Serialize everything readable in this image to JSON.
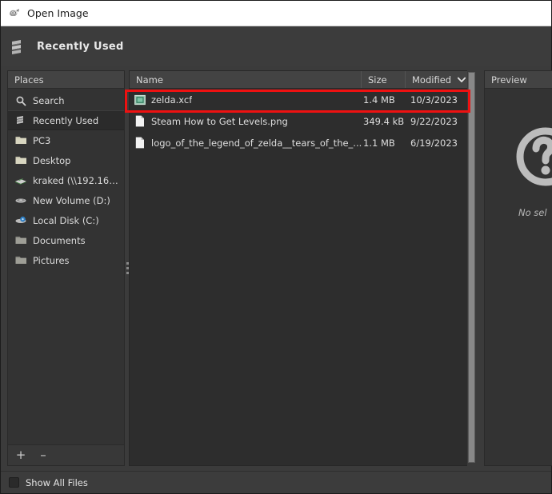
{
  "window": {
    "title": "Open Image",
    "title_icon": "gimp-wilber-icon"
  },
  "location_header": {
    "label": "Recently Used",
    "icon": "recently-used-stack-icon"
  },
  "sidebar": {
    "header": "Places",
    "items": [
      {
        "label": "Search",
        "icon": "search-icon",
        "selected": false
      },
      {
        "label": "Recently Used",
        "icon": "recent-stack-icon",
        "selected": true
      },
      {
        "label": "PC3",
        "icon": "folder-icon",
        "selected": false
      },
      {
        "label": "Desktop",
        "icon": "folder-icon",
        "selected": false
      },
      {
        "label": "kraked (\\\\192.168....",
        "icon": "network-drive-icon",
        "selected": false
      },
      {
        "label": "New Volume (D:)",
        "icon": "drive-icon",
        "selected": false
      },
      {
        "label": "Local Disk (C:)",
        "icon": "disk-icon",
        "selected": false
      },
      {
        "label": "Documents",
        "icon": "folder-gray-icon",
        "selected": false
      },
      {
        "label": "Pictures",
        "icon": "folder-gray-icon",
        "selected": false
      }
    ],
    "add_button": "+",
    "remove_button": "–"
  },
  "file_list": {
    "columns": {
      "name": "Name",
      "size": "Size",
      "modified": "Modified"
    },
    "sort_column": "Modified",
    "sort_caret": "chevron-down-icon",
    "rows": [
      {
        "name": "zelda.xcf",
        "size": "1.4 MB",
        "modified": "10/3/2023",
        "icon": "xcf-image-file-icon",
        "highlighted": true
      },
      {
        "name": "Steam How to Get Levels.png",
        "size": "349.4 kB",
        "modified": "9/22/2023",
        "icon": "document-file-icon",
        "highlighted": false
      },
      {
        "name": "logo_of_the_legend_of_zelda__tears_of_the_...",
        "size": "1.1 MB",
        "modified": "6/19/2023",
        "icon": "document-file-icon",
        "highlighted": false
      }
    ]
  },
  "preview": {
    "header": "Preview",
    "icon": "question-mark-circle-icon",
    "empty_text": "No sel"
  },
  "bottom": {
    "show_all_files_label": "Show All Files"
  },
  "colors": {
    "annotation_red": "#ee1111",
    "panel_bg": "#333333",
    "list_bg": "#2d2d2d",
    "header_bg": "#434343",
    "window_bg": "#3b3b3b",
    "titlebar_bg": "#ffffff",
    "text": "#dedede"
  }
}
